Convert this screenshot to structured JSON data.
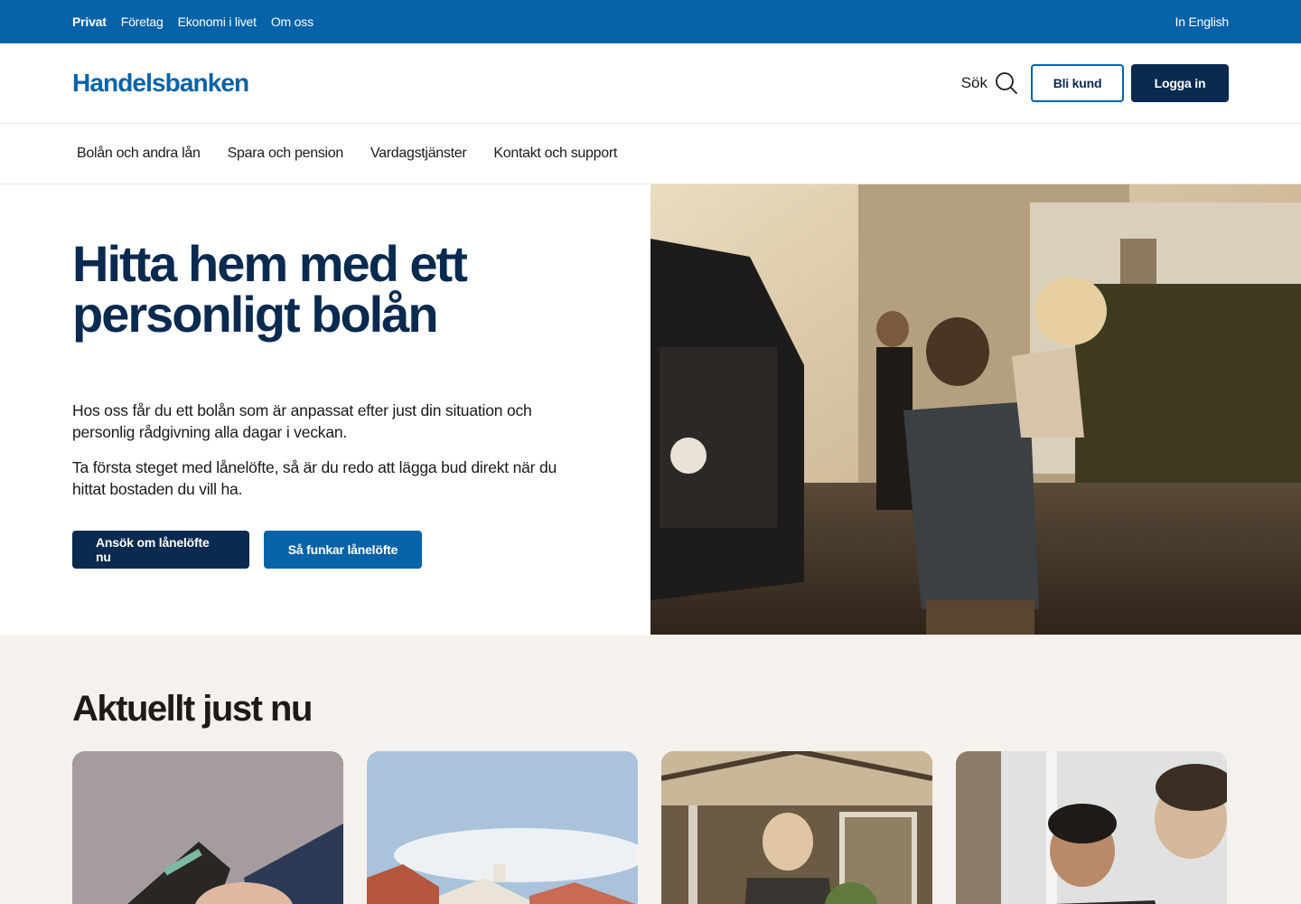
{
  "topbar": {
    "segments": [
      "Privat",
      "Företag",
      "Ekonomi i livet",
      "Om oss"
    ],
    "language": "In English"
  },
  "header": {
    "logo": "Handelsbanken",
    "search_label": "Sök",
    "become_customer": "Bli kund",
    "login": "Logga in"
  },
  "nav": {
    "items": [
      "Bolån och andra lån",
      "Spara och pension",
      "Vardagstjänster",
      "Kontakt och support"
    ]
  },
  "hero": {
    "title_line1": "Hitta hem med ett",
    "title_line2": "personligt bolån",
    "paragraph1": "Hos oss får du ett bolån som är anpassat efter just din situation och personlig rådgivning alla dagar i veckan.",
    "paragraph2": "Ta första steget med lånelöfte, så är du redo att lägga bud direkt när du hittat bostaden du vill ha.",
    "primary_button": "Ansök om lånelöfte nu",
    "secondary_button": "Så funkar lånelöfte"
  },
  "news": {
    "title": "Aktuellt just nu"
  },
  "colors": {
    "brand_blue": "#0762a8",
    "dark_navy": "#0a2a4f",
    "news_bg": "#f5f1ec"
  }
}
